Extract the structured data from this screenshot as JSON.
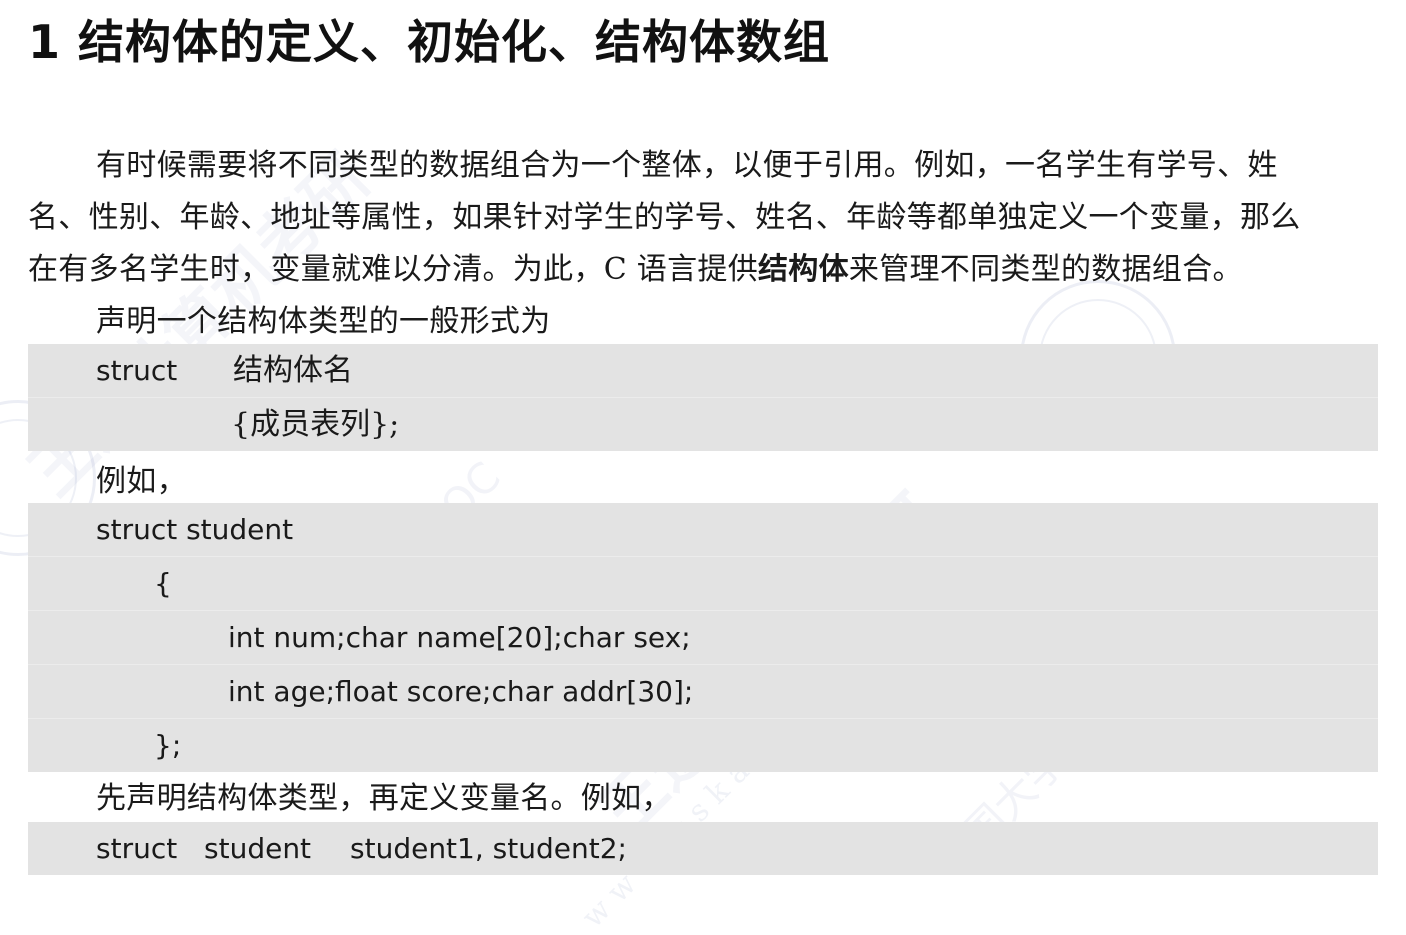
{
  "heading": "1  结构体的定义、初始化、结构体数组",
  "intro": {
    "line1": "有时候需要将不同类型的数据组合为一个整体，以便于引用。例如，一名学生有学号、姓",
    "line2": "名、性别、年龄、地址等属性，如果针对学生的学号、姓名、年龄等都单独定义一个变量，那么",
    "line3_before": "在有多名学生时，变量就难以分清。为此，C 语言提供",
    "line3_strong": "结构体",
    "line3_after": "来管理不同类型的数据组合。"
  },
  "general_form_label": "声明一个结构体类型的一般形式为",
  "general_form": {
    "keyword": "struct",
    "name": "结构体名",
    "members": "{成员表列};"
  },
  "example_label": "例如，",
  "example_code": {
    "line1": "struct student",
    "line2": "{",
    "line3": "int num;char name[20];char sex;",
    "line4": "int age;float score;char addr[30];",
    "line5": "};"
  },
  "declare_label": "先声明结构体类型，再定义变量名。例如，",
  "declare_code": {
    "keyword": "struct",
    "type": "student",
    "vars": "student1, student2;"
  },
  "watermarks": [
    "王道计算机考研",
    "中国大学MOOC",
    "www.cskaoyan.com",
    "中国大学MOOC",
    "王道计算机考研"
  ]
}
